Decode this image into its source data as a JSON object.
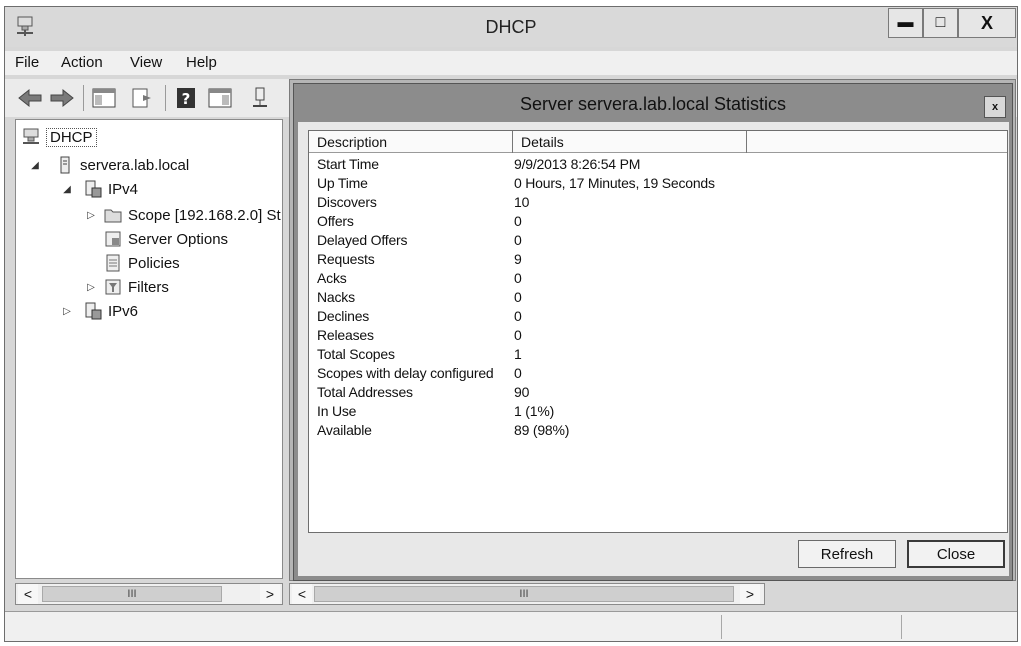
{
  "window": {
    "title": "DHCP"
  },
  "menu": [
    "File",
    "Action",
    "View",
    "Help"
  ],
  "tree": {
    "root": "DHCP",
    "server": "servera.lab.local",
    "ipv4": "IPv4",
    "scope": "Scope [192.168.2.0] St",
    "server_options": "Server Options",
    "policies": "Policies",
    "filters": "Filters",
    "ipv6": "IPv6"
  },
  "dialog": {
    "title": "Server servera.lab.local Statistics",
    "close_glyph": "x",
    "columns": [
      "Description",
      "Details"
    ],
    "rows": [
      {
        "description": "Start Time",
        "details": "9/9/2013 8:26:54 PM"
      },
      {
        "description": "Up Time",
        "details": "0 Hours, 17 Minutes, 19 Seconds"
      },
      {
        "description": "Discovers",
        "details": "10"
      },
      {
        "description": "Offers",
        "details": "0"
      },
      {
        "description": "Delayed Offers",
        "details": "0"
      },
      {
        "description": "Requests",
        "details": "9"
      },
      {
        "description": "Acks",
        "details": "0"
      },
      {
        "description": "Nacks",
        "details": "0"
      },
      {
        "description": "Declines",
        "details": "0"
      },
      {
        "description": "Releases",
        "details": "0"
      },
      {
        "description": "Total Scopes",
        "details": "1"
      },
      {
        "description": "Scopes with delay configured",
        "details": "0"
      },
      {
        "description": "Total Addresses",
        "details": "90"
      },
      {
        "description": "In Use",
        "details": "1 (1%)"
      },
      {
        "description": "Available",
        "details": "89 (98%)"
      }
    ],
    "refresh_label": "Refresh",
    "close_label": "Close"
  },
  "scroll": {
    "left_arrow": "<",
    "right_arrow": ">",
    "thumb_grip": "III"
  },
  "window_buttons": {
    "minimize": "▬",
    "maximize": "□",
    "close": "X"
  },
  "tree_expanders": {
    "expanded": "◢",
    "collapsed": "▷"
  },
  "icons": {
    "app": "dhcp-icon",
    "back": "back-arrow-icon",
    "forward": "forward-arrow-icon",
    "console_tree": "show-hide-console-tree-icon",
    "export": "export-list-icon",
    "help": "help-icon",
    "action_pane": "show-action-pane-icon",
    "server": "server-icon"
  }
}
